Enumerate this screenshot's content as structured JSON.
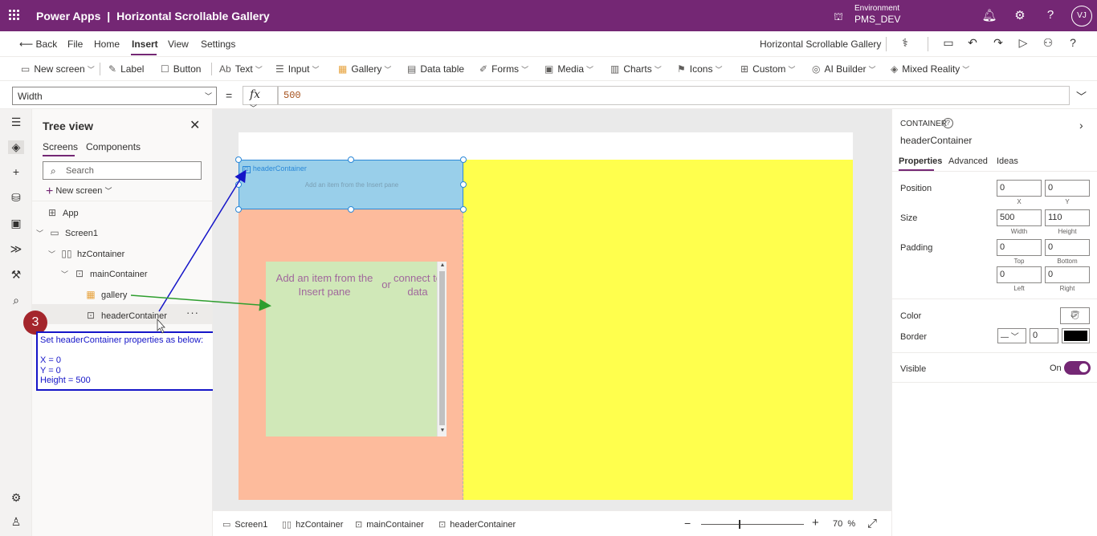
{
  "topbar": {
    "app_name": "Power Apps",
    "separator": "|",
    "app_title": "Horizontal Scrollable Gallery",
    "env_label": "Environment",
    "env_name": "PMS_DEV",
    "avatar": "VJ",
    "icons": [
      "waffle-icon",
      "environment-icon",
      "bell-icon",
      "gear-icon",
      "help-icon"
    ]
  },
  "menubar": {
    "back": "Back",
    "items": [
      "File",
      "Home",
      "Insert",
      "View",
      "Settings"
    ],
    "active": "Insert",
    "app_title": "Horizontal Scrollable Gallery",
    "icons": [
      "stethoscope-icon",
      "comment-icon",
      "undo-icon",
      "redo-icon",
      "play-icon",
      "share-icon",
      "help-icon"
    ]
  },
  "ribbon": {
    "items": [
      {
        "label": "New screen",
        "icon": "new-screen-icon",
        "chevron": true
      },
      {
        "label": "Label",
        "icon": "label-icon",
        "chevron": false
      },
      {
        "label": "Button",
        "icon": "button-icon",
        "chevron": false
      },
      {
        "label": "Text",
        "icon": "text-icon",
        "chevron": true
      },
      {
        "label": "Input",
        "icon": "input-icon",
        "chevron": true
      },
      {
        "label": "Gallery",
        "icon": "gallery-icon",
        "chevron": true
      },
      {
        "label": "Data table",
        "icon": "data-table-icon",
        "chevron": false
      },
      {
        "label": "Forms",
        "icon": "forms-icon",
        "chevron": true
      },
      {
        "label": "Media",
        "icon": "media-icon",
        "chevron": true
      },
      {
        "label": "Charts",
        "icon": "charts-icon",
        "chevron": true
      },
      {
        "label": "Icons",
        "icon": "icons-icon",
        "chevron": true
      },
      {
        "label": "Custom",
        "icon": "custom-icon",
        "chevron": true
      },
      {
        "label": "AI Builder",
        "icon": "ai-builder-icon",
        "chevron": true
      },
      {
        "label": "Mixed Reality",
        "icon": "mixed-reality-icon",
        "chevron": true
      }
    ]
  },
  "formula": {
    "property": "Width",
    "equals": "=",
    "fx": "fx",
    "value": "500"
  },
  "tree": {
    "title": "Tree view",
    "tabs": [
      "Screens",
      "Components"
    ],
    "search_placeholder": "Search",
    "new_screen": "New screen",
    "nodes": {
      "app": "App",
      "screen1": "Screen1",
      "hzContainer": "hzContainer",
      "mainContainer": "mainContainer",
      "gallery": "gallery",
      "headerContainer": "headerContainer"
    },
    "more": "···"
  },
  "callout": {
    "step": "3",
    "text": "Set headerContainer properties as below:\n\nX = 0\nY = 0\nHeight = 500",
    "color": "#1515c8"
  },
  "canvas": {
    "header_label": "headerContainer",
    "header_hint": "Add an item from the Insert pane",
    "gallery_hint_left": "Add an item from the Insert pane",
    "gallery_hint_or": "or",
    "gallery_hint_right": "connect to data",
    "colors": {
      "hzContainer": "#ffff4d",
      "mainContainer": "#fdbb9c",
      "headerContainer": "#99cfea",
      "gallery": "#d0e8b8"
    }
  },
  "statusbar": {
    "crumbs": [
      "Screen1",
      "hzContainer",
      "mainContainer",
      "headerContainer"
    ],
    "zoom": "70",
    "zoom_unit": "%"
  },
  "props": {
    "type": "CONTAINER",
    "name": "headerContainer",
    "tabs": [
      "Properties",
      "Advanced",
      "Ideas"
    ],
    "position_label": "Position",
    "x": "0",
    "y": "0",
    "x_label": "X",
    "y_label": "Y",
    "size_label": "Size",
    "width": "500",
    "height": "110",
    "width_label": "Width",
    "height_label": "Height",
    "padding_label": "Padding",
    "padding_top": "0",
    "padding_bottom": "0",
    "padding_left": "0",
    "padding_right": "0",
    "top_label": "Top",
    "bottom_label": "Bottom",
    "left_label": "Left",
    "right_label": "Right",
    "color_label": "Color",
    "border_label": "Border",
    "border_width": "0",
    "border_color": "#000000",
    "visible_label": "Visible",
    "visible_state": "On"
  }
}
